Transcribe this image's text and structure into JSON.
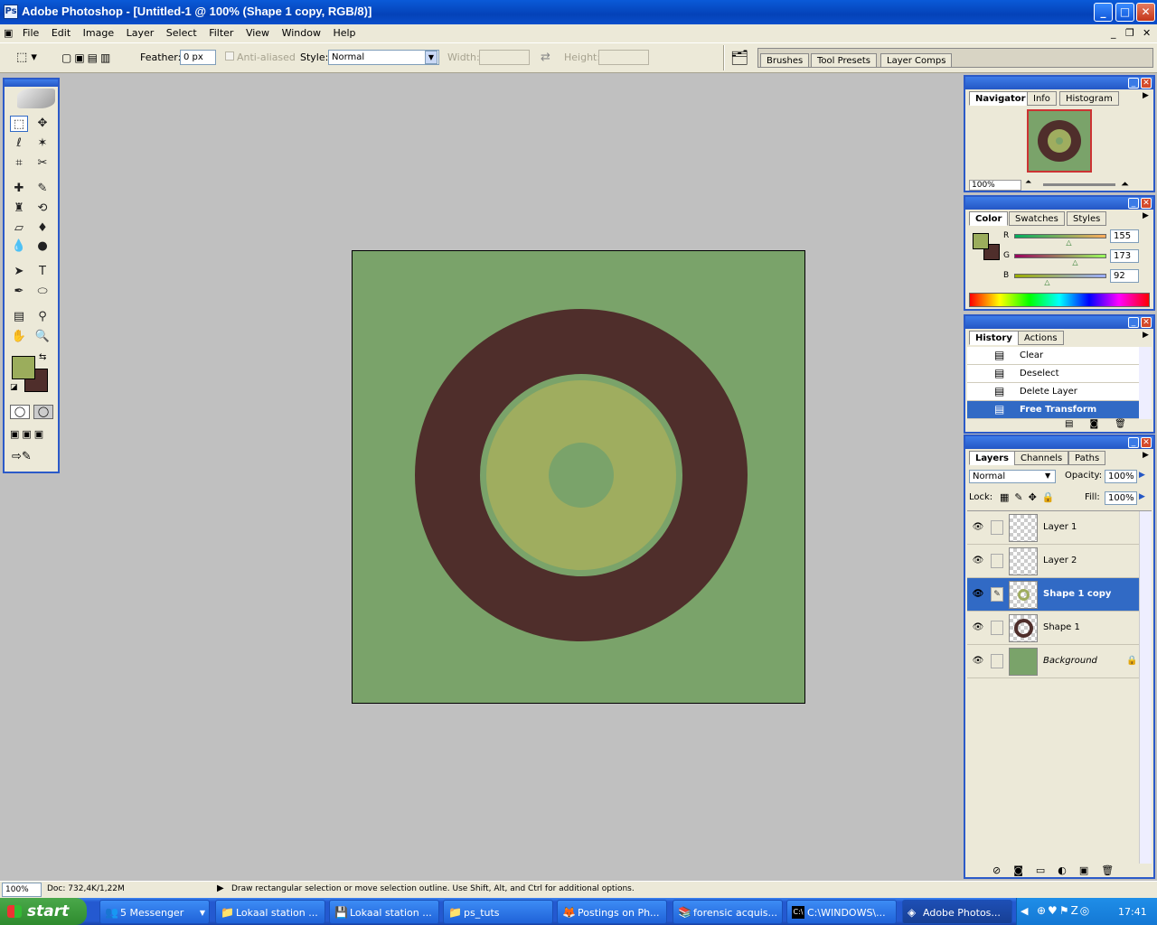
{
  "titlebar": {
    "title": "Adobe Photoshop - [Untitled-1 @ 100% (Shape 1 copy, RGB/8)]",
    "min": "_",
    "max": "□",
    "close": "✕"
  },
  "menu": [
    "File",
    "Edit",
    "Image",
    "Layer",
    "Select",
    "Filter",
    "View",
    "Window",
    "Help"
  ],
  "doc_controls": {
    "min": "_",
    "restore": "❐",
    "close": "✕"
  },
  "options": {
    "feather_label": "Feather:",
    "feather_value": "0 px",
    "antialias_label": "Anti-aliased",
    "style_label": "Style:",
    "style_value": "Normal",
    "width_label": "Width:",
    "height_label": "Height:"
  },
  "palette_well": {
    "tabs": [
      "Brushes",
      "Tool Presets",
      "Layer Comps"
    ]
  },
  "toolbox": {
    "tools": [
      "rect-marquee",
      "move",
      "lasso",
      "magic-wand",
      "crop",
      "slice",
      "healing-brush",
      "brush",
      "clone-stamp",
      "history-brush",
      "eraser",
      "paint-bucket",
      "blur",
      "dodge",
      "path-select",
      "type",
      "pen",
      "ellipse-shape",
      "notes",
      "eyedropper",
      "hand",
      "zoom"
    ],
    "foreground": "#9bad5c",
    "background": "#4f2e2b"
  },
  "canvas": {
    "bg": "#7aa36a",
    "ring_outer": "#4f2e2b",
    "ring_inner": "#9fad5f",
    "center": "#7aa36a"
  },
  "navigator": {
    "tabs": [
      "Navigator",
      "Info",
      "Histogram"
    ],
    "zoom": "100%"
  },
  "color": {
    "tabs": [
      "Color",
      "Swatches",
      "Styles"
    ],
    "r_label": "R",
    "r": "155",
    "g_label": "G",
    "g": "173",
    "b_label": "B",
    "b": "92",
    "fg": "#9bad5c",
    "bg": "#4f2e2b"
  },
  "history": {
    "tabs": [
      "History",
      "Actions"
    ],
    "items": [
      "Clear",
      "Deselect",
      "Delete Layer",
      "Free Transform"
    ]
  },
  "layers": {
    "tabs": [
      "Layers",
      "Channels",
      "Paths"
    ],
    "mode": "Normal",
    "opacity_label": "Opacity:",
    "opacity": "100%",
    "lock_label": "Lock:",
    "fill_label": "Fill:",
    "fill": "100%",
    "items": [
      {
        "name": "Layer 1"
      },
      {
        "name": "Layer 2"
      },
      {
        "name": "Shape 1 copy"
      },
      {
        "name": "Shape 1"
      },
      {
        "name": "Background"
      }
    ]
  },
  "status": {
    "zoom": "100%",
    "doc": "Doc: 732,4K/1,22M",
    "hint": "Draw rectangular selection or move selection outline.  Use Shift, Alt, and Ctrl for additional options."
  },
  "taskbar": {
    "start": "start",
    "tasks": [
      "5 Messenger",
      "Lokaal station ...",
      "Lokaal station ...",
      "ps_tuts",
      "Postings on Ph...",
      "forensic acquis...",
      "C:\\WINDOWS\\...",
      "Adobe Photos..."
    ],
    "clock": "17:41"
  }
}
